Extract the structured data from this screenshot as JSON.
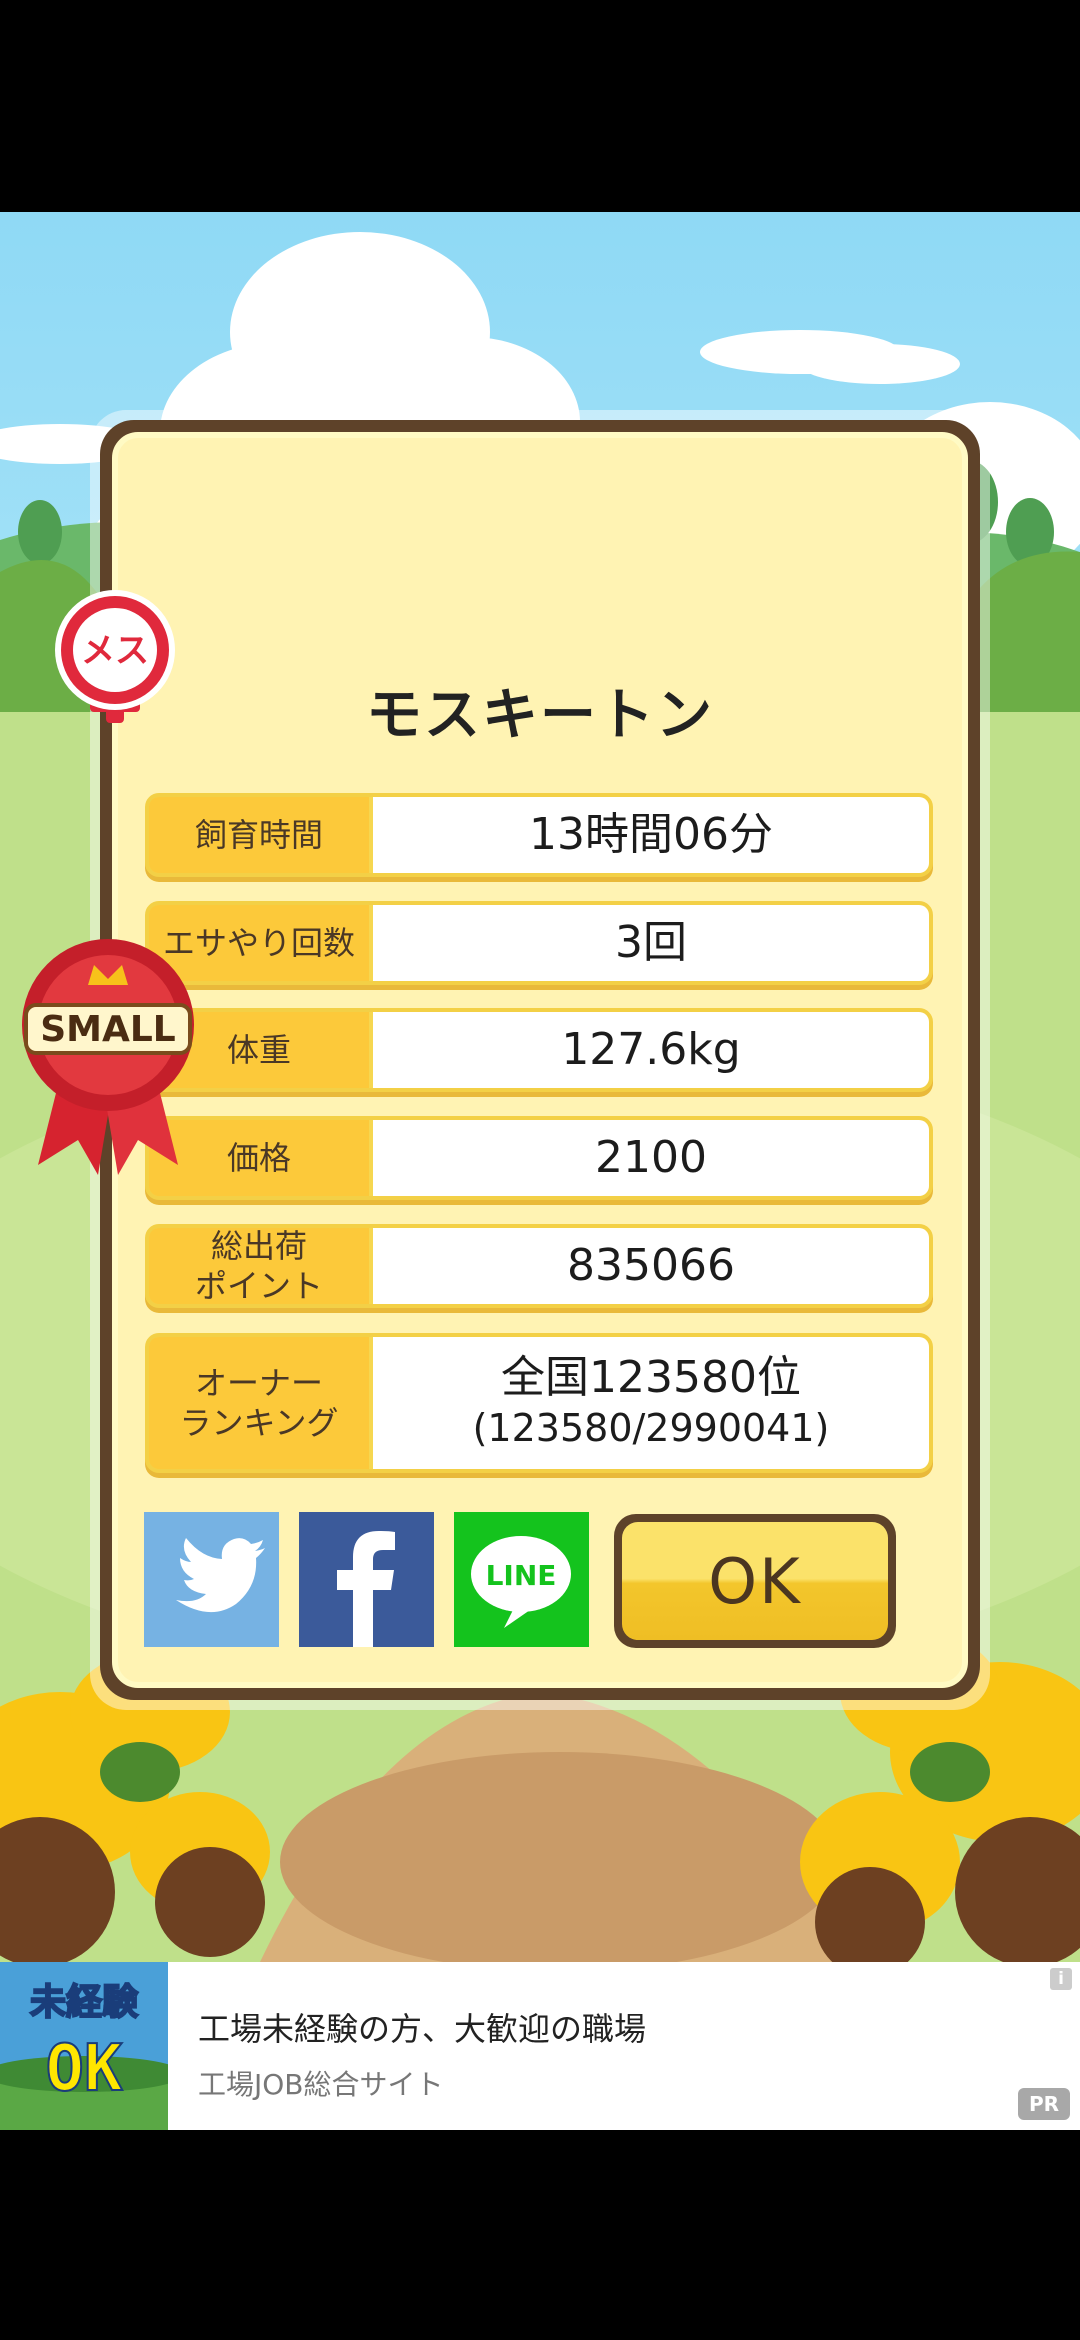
{
  "pet": {
    "name": "モスキートン",
    "gender_label": "メス",
    "size_label": "SMALL"
  },
  "stats": [
    {
      "label": "飼育時間",
      "value": "13時間06分"
    },
    {
      "label": "エサやり回数",
      "value": "3回"
    },
    {
      "label": "体重",
      "value": "127.6kg"
    },
    {
      "label": "価格",
      "value": "2100"
    },
    {
      "label": "総出荷\nポイント",
      "value": "835066"
    },
    {
      "label": "オーナー\nランキング",
      "value": "全国123580位",
      "value_sub": "(123580/2990041)"
    }
  ],
  "share": {
    "twitter_icon": "twitter-bird-icon",
    "facebook_icon": "facebook-f-icon",
    "line_label": "LINE"
  },
  "ok_label": "OK",
  "ad": {
    "image_text_top": "未経験",
    "image_text_bottom": "OK",
    "title": "工場未経験の方、大歓迎の職場",
    "subtitle": "工場JOB総合サイト",
    "info_label": "i",
    "pr_label": "PR"
  },
  "colors": {
    "card_border": "#5e4229",
    "card_fill": "#fff3b3",
    "row_label_fill": "#fcc93a",
    "twitter": "#76b2e3",
    "facebook": "#3b5a9a",
    "line": "#14c31d"
  }
}
